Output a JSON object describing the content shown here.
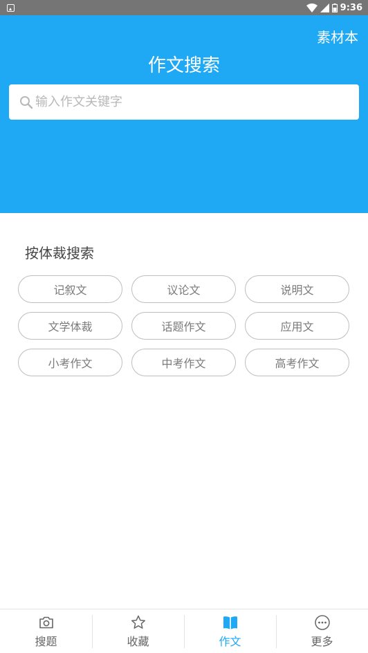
{
  "status_bar": {
    "time": "9:36",
    "icons": [
      "notification-icon",
      "wifi-icon",
      "signal-icon",
      "battery-icon"
    ]
  },
  "header": {
    "material_link": "素材本",
    "title": "作文搜索",
    "background_color": "#1fa9f5"
  },
  "search": {
    "placeholder": "输入作文关键字",
    "value": "",
    "icon": "search-icon"
  },
  "genre_section": {
    "title": "按体裁搜索",
    "items": [
      {
        "label": "记叙文"
      },
      {
        "label": "议论文"
      },
      {
        "label": "说明文"
      },
      {
        "label": "文学体裁"
      },
      {
        "label": "话题作文"
      },
      {
        "label": "应用文"
      },
      {
        "label": "小考作文"
      },
      {
        "label": "中考作文"
      },
      {
        "label": "高考作文"
      }
    ]
  },
  "bottom_nav": {
    "active_color": "#1fa9f5",
    "items": [
      {
        "label": "搜题",
        "icon": "camera-icon",
        "active": false
      },
      {
        "label": "收藏",
        "icon": "star-icon",
        "active": false
      },
      {
        "label": "作文",
        "icon": "book-icon",
        "active": true
      },
      {
        "label": "更多",
        "icon": "more-icon",
        "active": false
      }
    ]
  }
}
